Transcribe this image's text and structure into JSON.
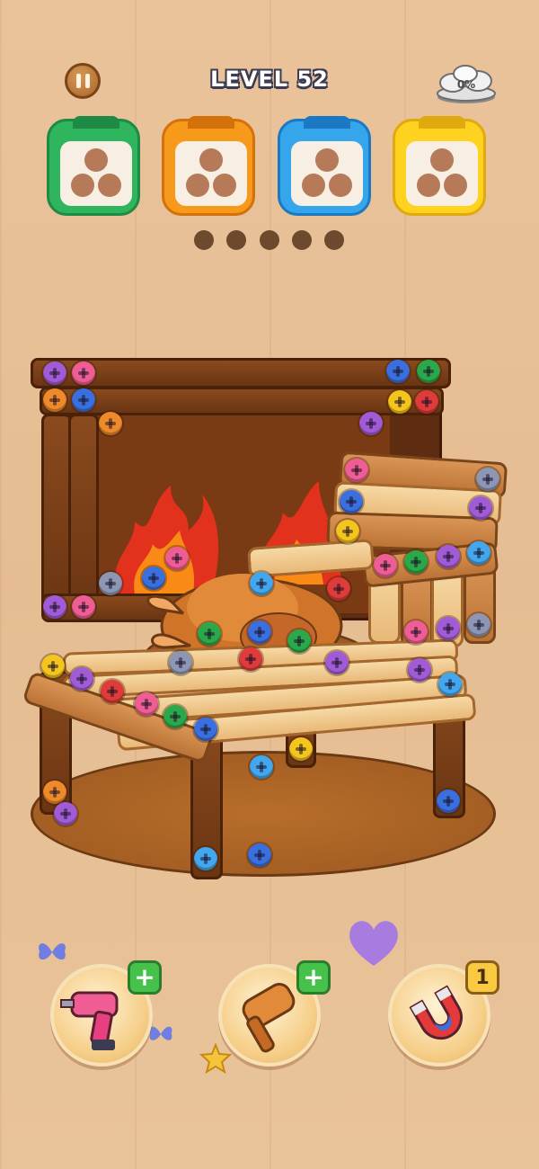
{
  "header": {
    "level_label": "LEVEL 52",
    "coin_progress": "0%"
  },
  "color_boxes": [
    {
      "color": "#2fb55e",
      "accent": "#1e8a43",
      "holes_filled": 0,
      "holes_total": 3
    },
    {
      "color": "#f79a1c",
      "accent": "#d3720b",
      "holes_filled": 0,
      "holes_total": 3
    },
    {
      "color": "#35a6ec",
      "accent": "#1b79c4",
      "holes_filled": 0,
      "holes_total": 3
    },
    {
      "color": "#ffd21f",
      "accent": "#e0a90d",
      "holes_filled": 0,
      "holes_total": 3
    }
  ],
  "queue_slots": 5,
  "tools": [
    {
      "name": "drill",
      "badge": "+"
    },
    {
      "name": "hammer",
      "badge": "+"
    },
    {
      "name": "magnet",
      "badge": "1"
    }
  ],
  "colors": {
    "background": "#e8c198",
    "wood_dark": "#7a3f17",
    "wood_light": "#f3cf94"
  }
}
